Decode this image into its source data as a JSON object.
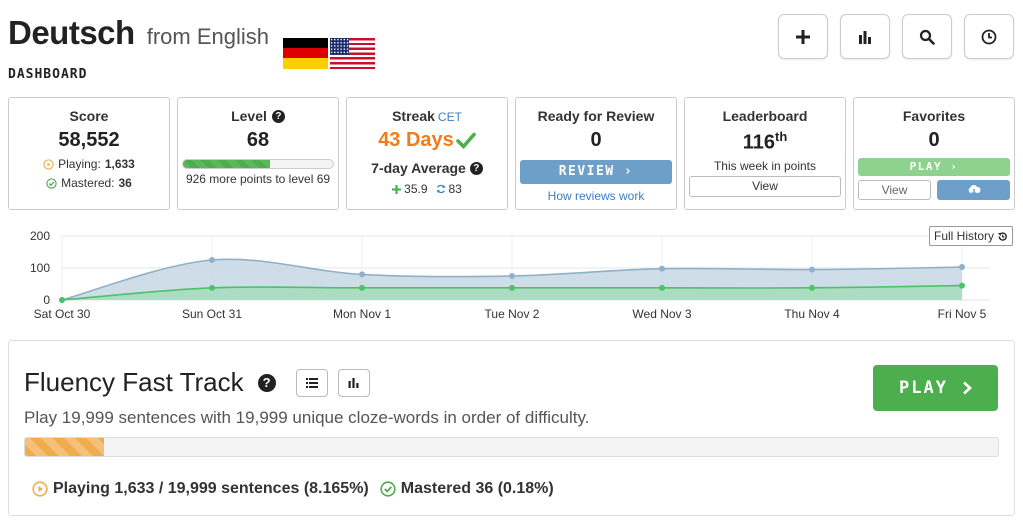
{
  "header": {
    "language": "Deutsch",
    "from_text": "from English",
    "dashboard_label": "DASHBOARD"
  },
  "top_buttons": [
    "plus-icon",
    "bar-chart-icon",
    "search-icon",
    "clock-icon"
  ],
  "cards": {
    "score": {
      "title": "Score",
      "value": "58,552",
      "playing_label": "Playing:",
      "playing_value": "1,633",
      "mastered_label": "Mastered:",
      "mastered_value": "36"
    },
    "level": {
      "title": "Level",
      "value": "68",
      "progress_fraction": 0.58,
      "note": "926 more points to level 69"
    },
    "streak": {
      "title": "Streak",
      "tz": "CET",
      "value": "43 Days",
      "avg_title": "7-day Average",
      "avg_plus": "35.9",
      "avg_reviews": "83"
    },
    "review": {
      "title": "Ready for Review",
      "value": "0",
      "button": "REVIEW",
      "link": "How reviews work"
    },
    "leaderboard": {
      "title": "Leaderboard",
      "value": "116",
      "suffix": "th",
      "note": "This week in points",
      "button": "View"
    },
    "favorites": {
      "title": "Favorites",
      "value": "0",
      "play_button": "PLAY",
      "view_button": "View"
    }
  },
  "full_history_label": "Full History",
  "chart_data": {
    "type": "area",
    "categories": [
      "Sat Oct 30",
      "Sun Oct 31",
      "Mon Nov 1",
      "Tue Nov 2",
      "Wed Nov 3",
      "Thu Nov 4",
      "Fri Nov 5"
    ],
    "series": [
      {
        "values": [
          0,
          125,
          80,
          75,
          98,
          95,
          103
        ],
        "color": "#8fb0c8"
      },
      {
        "values": [
          0,
          38,
          38,
          38,
          38,
          38,
          45
        ],
        "color": "#4cc26a"
      }
    ],
    "yticks": [
      "200",
      "100",
      "0"
    ],
    "ylim": [
      0,
      200
    ],
    "grid": true
  },
  "fluency": {
    "title": "Fluency Fast Track",
    "description": "Play 19,999 sentences with 19,999 unique cloze-words in order of difficulty.",
    "progress_fraction": 0.08165,
    "play_button": "PLAY",
    "playing_text": "Playing 1,633 / 19,999 sentences (8.165%)",
    "mastered_text": "Mastered 36 (0.18%)"
  },
  "colors": {
    "accent_blue": "#6e9fc9",
    "green": "#4cae4c",
    "orange": "#f07b1e"
  }
}
